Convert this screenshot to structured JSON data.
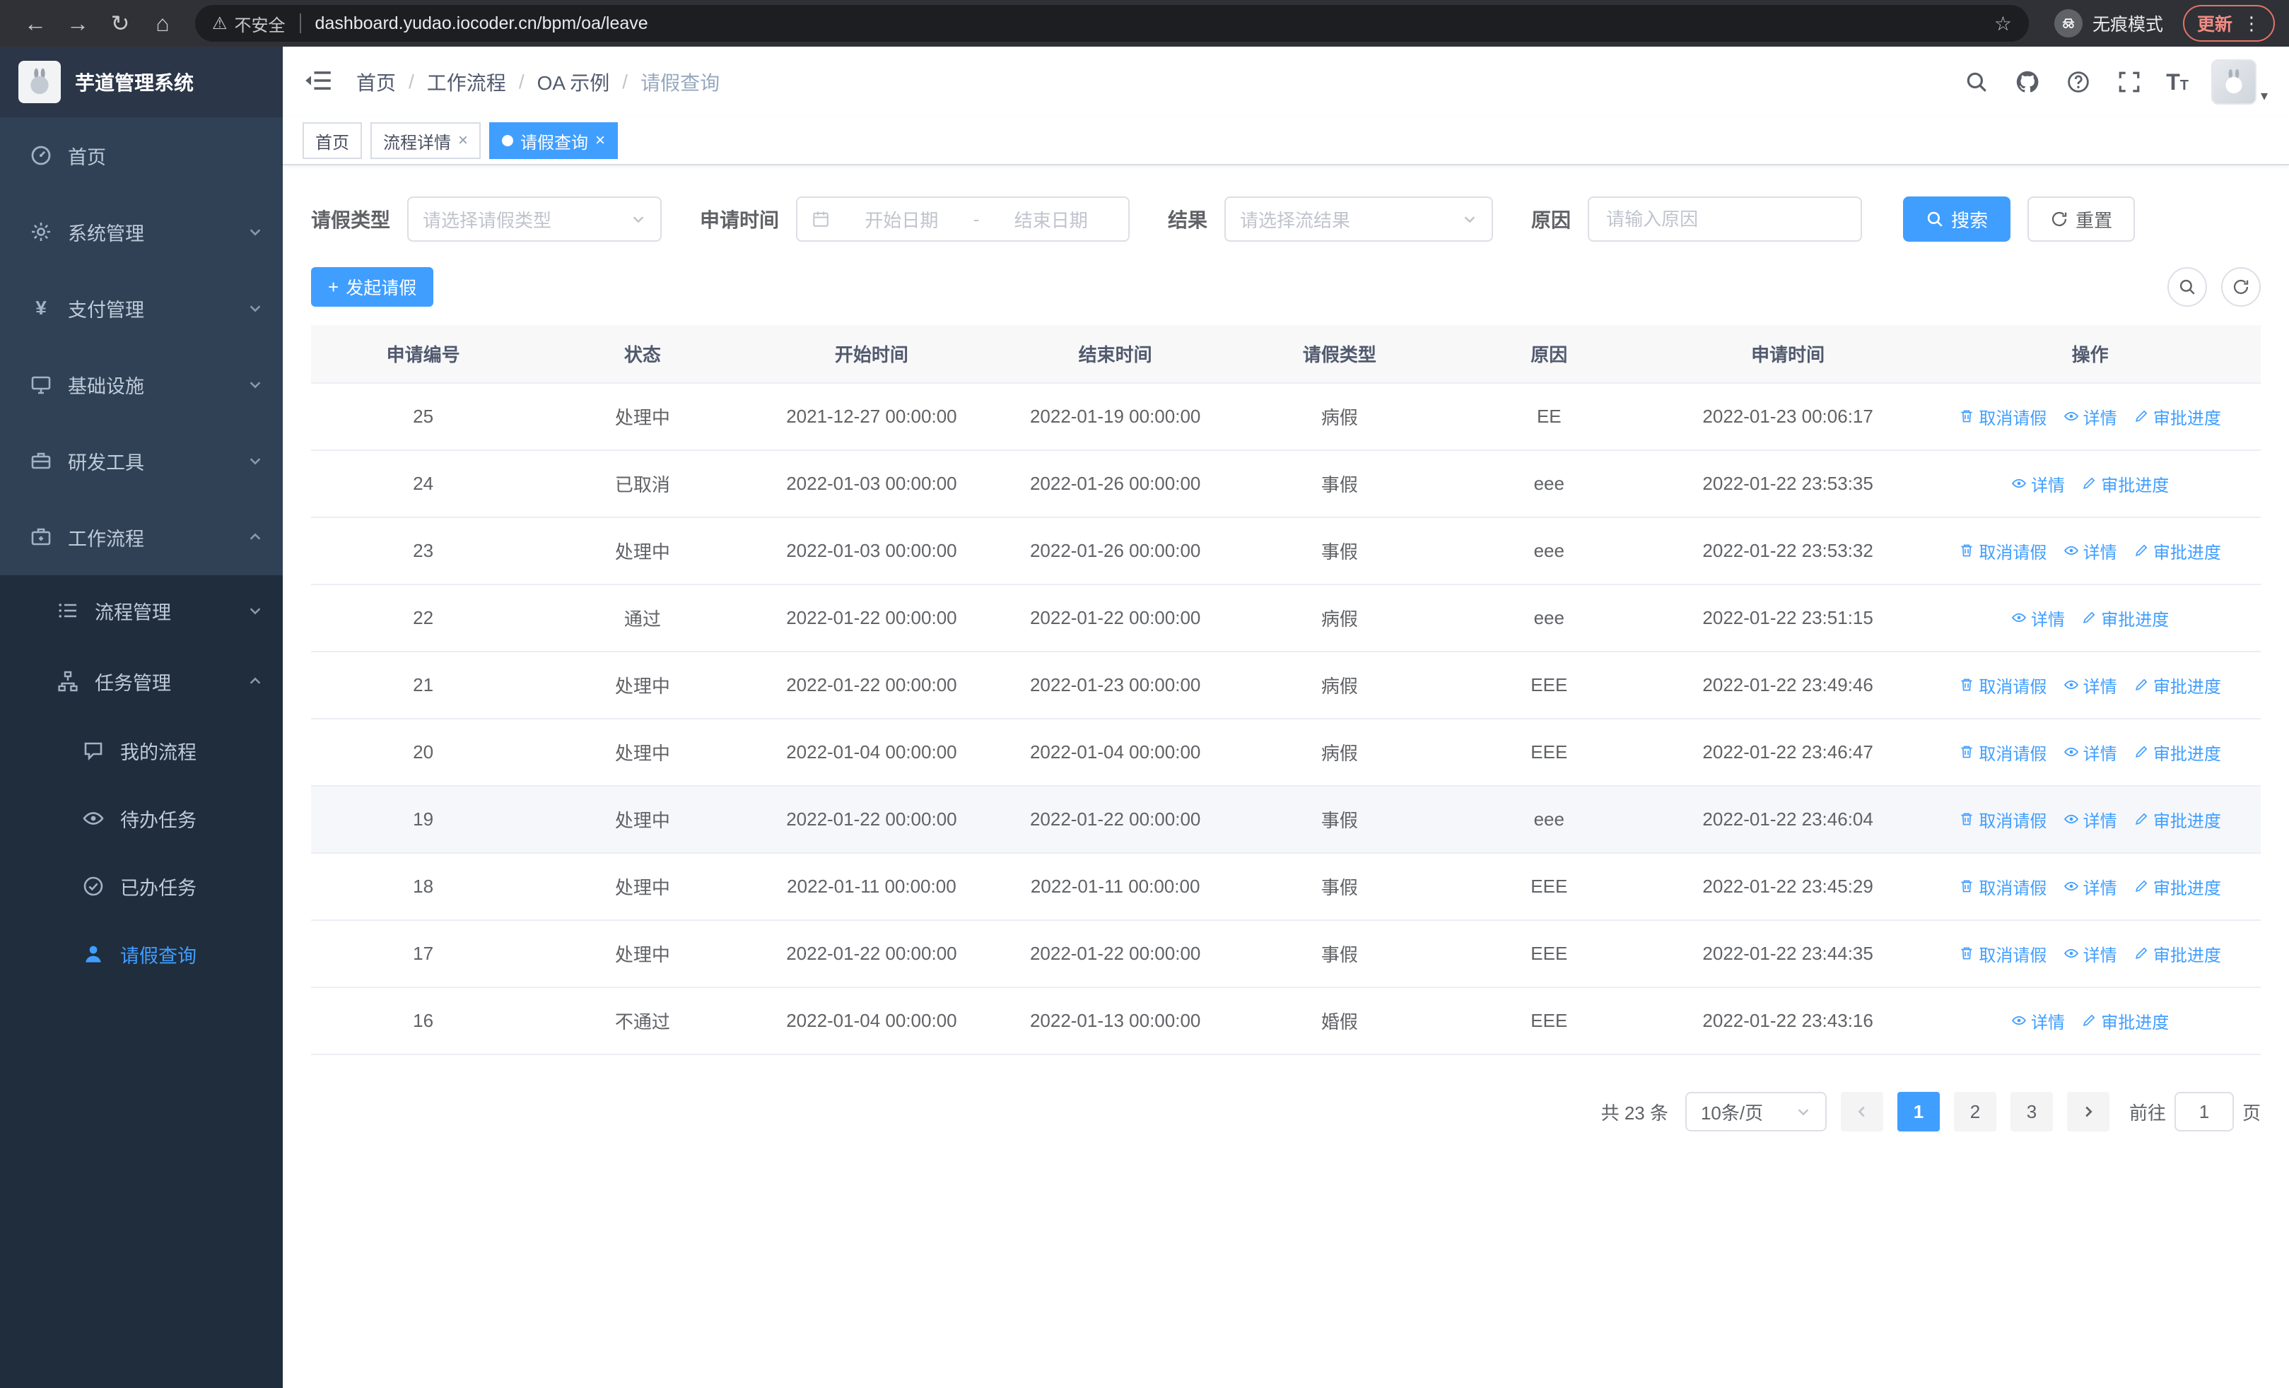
{
  "browser": {
    "not_secure": "不安全",
    "url": "dashboard.yudao.iocoder.cn/bpm/oa/leave",
    "incognito": "无痕模式",
    "update": "更新"
  },
  "sidebar": {
    "logo_title": "芋道管理系统",
    "items": [
      {
        "label": "首页",
        "icon": "dashboard-icon"
      },
      {
        "label": "系统管理",
        "icon": "gear-icon"
      },
      {
        "label": "支付管理",
        "icon": "yen-icon"
      },
      {
        "label": "基础设施",
        "icon": "monitor-icon"
      },
      {
        "label": "研发工具",
        "icon": "toolbox-icon"
      },
      {
        "label": "工作流程",
        "icon": "workflow-icon"
      }
    ],
    "workflow_children": [
      {
        "label": "流程管理",
        "icon": "list-icon"
      },
      {
        "label": "任务管理",
        "icon": "tree-icon"
      }
    ],
    "task_children": [
      {
        "label": "我的流程",
        "icon": "chat-icon"
      },
      {
        "label": "待办任务",
        "icon": "eye-icon"
      },
      {
        "label": "已办任务",
        "icon": "completed-icon"
      },
      {
        "label": "请假查询",
        "icon": "user-icon"
      }
    ]
  },
  "breadcrumb": {
    "items": [
      "首页",
      "工作流程",
      "OA 示例",
      "请假查询"
    ]
  },
  "tabs": [
    {
      "label": "首页"
    },
    {
      "label": "流程详情"
    },
    {
      "label": "请假查询"
    }
  ],
  "filters": {
    "leave_type_label": "请假类型",
    "leave_type_placeholder": "请选择请假类型",
    "apply_time_label": "申请时间",
    "start_date_placeholder": "开始日期",
    "range_separator": "-",
    "end_date_placeholder": "结束日期",
    "result_label": "结果",
    "result_placeholder": "请选择流结果",
    "reason_label": "原因",
    "reason_placeholder": "请输入原因",
    "search_button": "搜索",
    "reset_button": "重置"
  },
  "toolbar": {
    "create_button": "发起请假"
  },
  "table": {
    "columns": [
      "申请编号",
      "状态",
      "开始时间",
      "结束时间",
      "请假类型",
      "原因",
      "申请时间",
      "操作"
    ],
    "action_labels": {
      "cancel": "取消请假",
      "detail": "详情",
      "progress": "审批进度"
    },
    "rows": [
      {
        "id": "25",
        "status": "处理中",
        "start": "2021-12-27 00:00:00",
        "end": "2022-01-19 00:00:00",
        "type": "病假",
        "reason": "EE",
        "applied": "2022-01-23 00:06:17"
      },
      {
        "id": "24",
        "status": "已取消",
        "start": "2022-01-03 00:00:00",
        "end": "2022-01-26 00:00:00",
        "type": "事假",
        "reason": "eee",
        "applied": "2022-01-22 23:53:35"
      },
      {
        "id": "23",
        "status": "处理中",
        "start": "2022-01-03 00:00:00",
        "end": "2022-01-26 00:00:00",
        "type": "事假",
        "reason": "eee",
        "applied": "2022-01-22 23:53:32"
      },
      {
        "id": "22",
        "status": "通过",
        "start": "2022-01-22 00:00:00",
        "end": "2022-01-22 00:00:00",
        "type": "病假",
        "reason": "eee",
        "applied": "2022-01-22 23:51:15"
      },
      {
        "id": "21",
        "status": "处理中",
        "start": "2022-01-22 00:00:00",
        "end": "2022-01-23 00:00:00",
        "type": "病假",
        "reason": "EEE",
        "applied": "2022-01-22 23:49:46"
      },
      {
        "id": "20",
        "status": "处理中",
        "start": "2022-01-04 00:00:00",
        "end": "2022-01-04 00:00:00",
        "type": "病假",
        "reason": "EEE",
        "applied": "2022-01-22 23:46:47"
      },
      {
        "id": "19",
        "status": "处理中",
        "start": "2022-01-22 00:00:00",
        "end": "2022-01-22 00:00:00",
        "type": "事假",
        "reason": "eee",
        "applied": "2022-01-22 23:46:04"
      },
      {
        "id": "18",
        "status": "处理中",
        "start": "2022-01-11 00:00:00",
        "end": "2022-01-11 00:00:00",
        "type": "事假",
        "reason": "EEE",
        "applied": "2022-01-22 23:45:29"
      },
      {
        "id": "17",
        "status": "处理中",
        "start": "2022-01-22 00:00:00",
        "end": "2022-01-22 00:00:00",
        "type": "事假",
        "reason": "EEE",
        "applied": "2022-01-22 23:44:35"
      },
      {
        "id": "16",
        "status": "不通过",
        "start": "2022-01-04 00:00:00",
        "end": "2022-01-13 00:00:00",
        "type": "婚假",
        "reason": "EEE",
        "applied": "2022-01-22 23:43:16"
      }
    ]
  },
  "pagination": {
    "total": "共 23 条",
    "page_size": "10条/页",
    "pages": [
      "1",
      "2",
      "3"
    ],
    "goto_label": "前往",
    "goto_value": "1",
    "page_suffix": "页"
  },
  "colors": {
    "primary": "#409eff",
    "sidebar_bg": "#304156",
    "submenu_bg": "#1f2d3d"
  }
}
